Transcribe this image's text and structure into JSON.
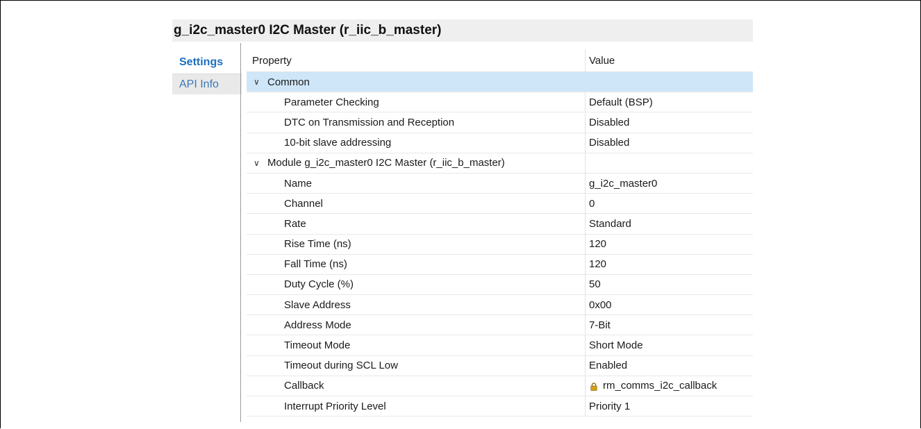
{
  "panel": {
    "title": "g_i2c_master0 I2C Master (r_iic_b_master)"
  },
  "tabs": [
    {
      "label": "Settings"
    },
    {
      "label": "API Info"
    }
  ],
  "table": {
    "headers": {
      "property": "Property",
      "value": "Value"
    },
    "groups": [
      {
        "label": "Common",
        "expanded": true,
        "selected": true,
        "rows": [
          {
            "property": "Parameter Checking",
            "value": "Default (BSP)"
          },
          {
            "property": "DTC on Transmission and Reception",
            "value": "Disabled"
          },
          {
            "property": "10-bit slave addressing",
            "value": "Disabled"
          }
        ]
      },
      {
        "label": "Module g_i2c_master0 I2C Master (r_iic_b_master)",
        "expanded": true,
        "selected": false,
        "rows": [
          {
            "property": "Name",
            "value": "g_i2c_master0"
          },
          {
            "property": "Channel",
            "value": "0"
          },
          {
            "property": "Rate",
            "value": "Standard"
          },
          {
            "property": "Rise Time (ns)",
            "value": "120"
          },
          {
            "property": "Fall Time (ns)",
            "value": "120"
          },
          {
            "property": "Duty Cycle (%)",
            "value": "50"
          },
          {
            "property": "Slave Address",
            "value": "0x00"
          },
          {
            "property": "Address Mode",
            "value": "7-Bit"
          },
          {
            "property": "Timeout Mode",
            "value": "Short Mode"
          },
          {
            "property": "Timeout during SCL Low",
            "value": "Enabled"
          },
          {
            "property": "Callback",
            "value": "rm_comms_i2c_callback",
            "icon": "lock-icon"
          },
          {
            "property": "Interrupt Priority Level",
            "value": "Priority 1"
          }
        ]
      }
    ]
  },
  "colors": {
    "selection": "#cfe6f8",
    "tab_active": "#1d6fbf",
    "lock": "#d4a017"
  }
}
